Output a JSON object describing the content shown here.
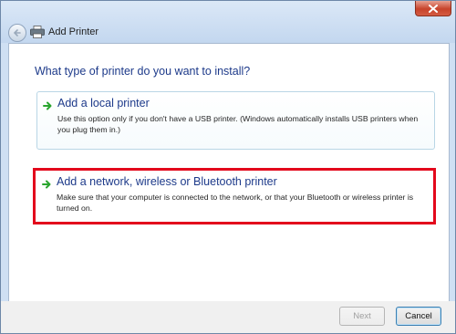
{
  "window": {
    "title": "Add Printer"
  },
  "page": {
    "heading": "What type of printer do you want to install?"
  },
  "options": [
    {
      "title": "Add a local printer",
      "description": "Use this option only if you don't have a USB printer. (Windows automatically installs USB printers when you plug them in.)"
    },
    {
      "title": "Add a network, wireless or Bluetooth printer",
      "description": "Make sure that your computer is connected to the network, or that your Bluetooth or wireless printer is turned on."
    }
  ],
  "footer": {
    "next_label": "Next",
    "cancel_label": "Cancel"
  },
  "colors": {
    "heading": "#1d3a8a",
    "highlight": "#e3081c",
    "arrow": "#2aa52e"
  },
  "icons": [
    "close-icon",
    "back-arrow-icon",
    "printer-icon",
    "green-arrow-icon"
  ]
}
